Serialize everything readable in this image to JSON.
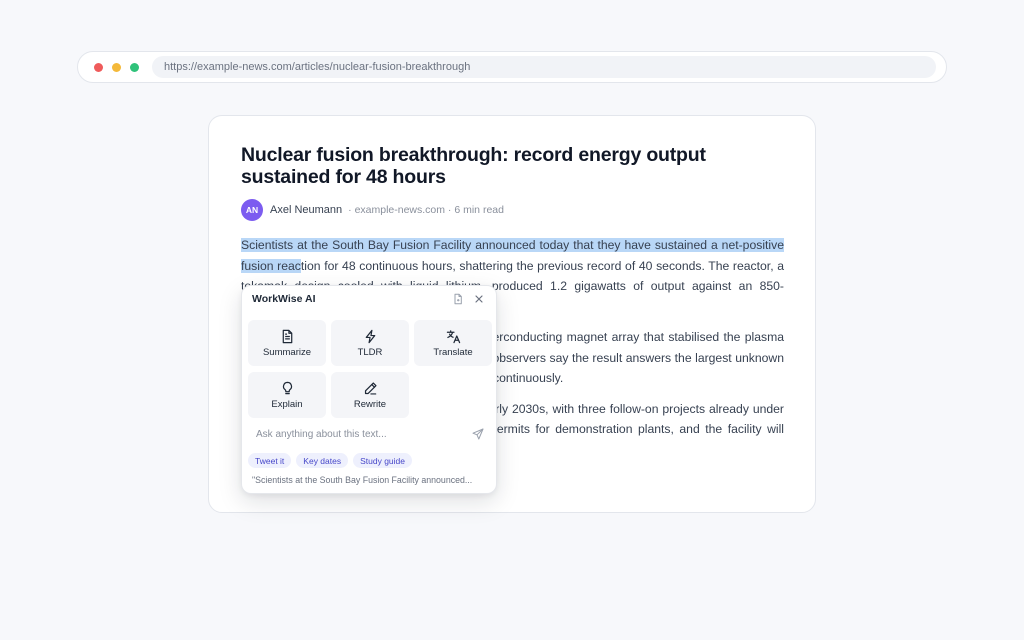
{
  "browser": {
    "url": "https://example-news.com/articles/nuclear-fusion-breakthrough"
  },
  "article": {
    "title": "Nuclear fusion breakthrough: record energy output sustained for 48 hours",
    "author_initials": "AN",
    "author": "Axel Neumann",
    "meta": "· example-news.com · 6 min read",
    "p1_highlighted": "Scientists at the South Bay Fusion Facility announced today that they have sustained a net-positive fusion reac",
    "p1_rest": "tion for 48 continuous hours, shattering the previous record of 40 seconds. The reactor, a tokamak design cooled with liquid lithium, produced 1.2 gigawatts of output against an 850-megawatt input.",
    "p2": "The team credits a new high-temperature superconducting magnet array that stabilised the plasma inside the compact 4-metre chamber. Industry observers say the result answers the largest unknown in fusion economics: whether reactors can run continuously.",
    "p3": "Commercial pilot plants are targeted for the early 2030s, with three follow-on projects already under review. Regulators have signalled fast-track permits for demonstration plants, and the facility will publish full telemetry next quarter."
  },
  "ai_popup": {
    "title": "WorkWise AI",
    "actions": [
      {
        "label": "Summarize",
        "icon": "document-icon"
      },
      {
        "label": "TLDR",
        "icon": "lightning-icon"
      },
      {
        "label": "Translate",
        "icon": "translate-icon"
      },
      {
        "label": "Explain",
        "icon": "lightbulb-icon"
      },
      {
        "label": "Rewrite",
        "icon": "pencil-icon"
      }
    ],
    "ask_placeholder": "Ask anything about this text...",
    "chips": [
      "Tweet it",
      "Key dates",
      "Study guide"
    ],
    "quote": "\"Scientists at the South Bay Fusion Facility announced..."
  },
  "colors": {
    "highlight": "#b9d7f7",
    "avatar": "#7c5cf0",
    "chip_text": "#4747c9"
  }
}
